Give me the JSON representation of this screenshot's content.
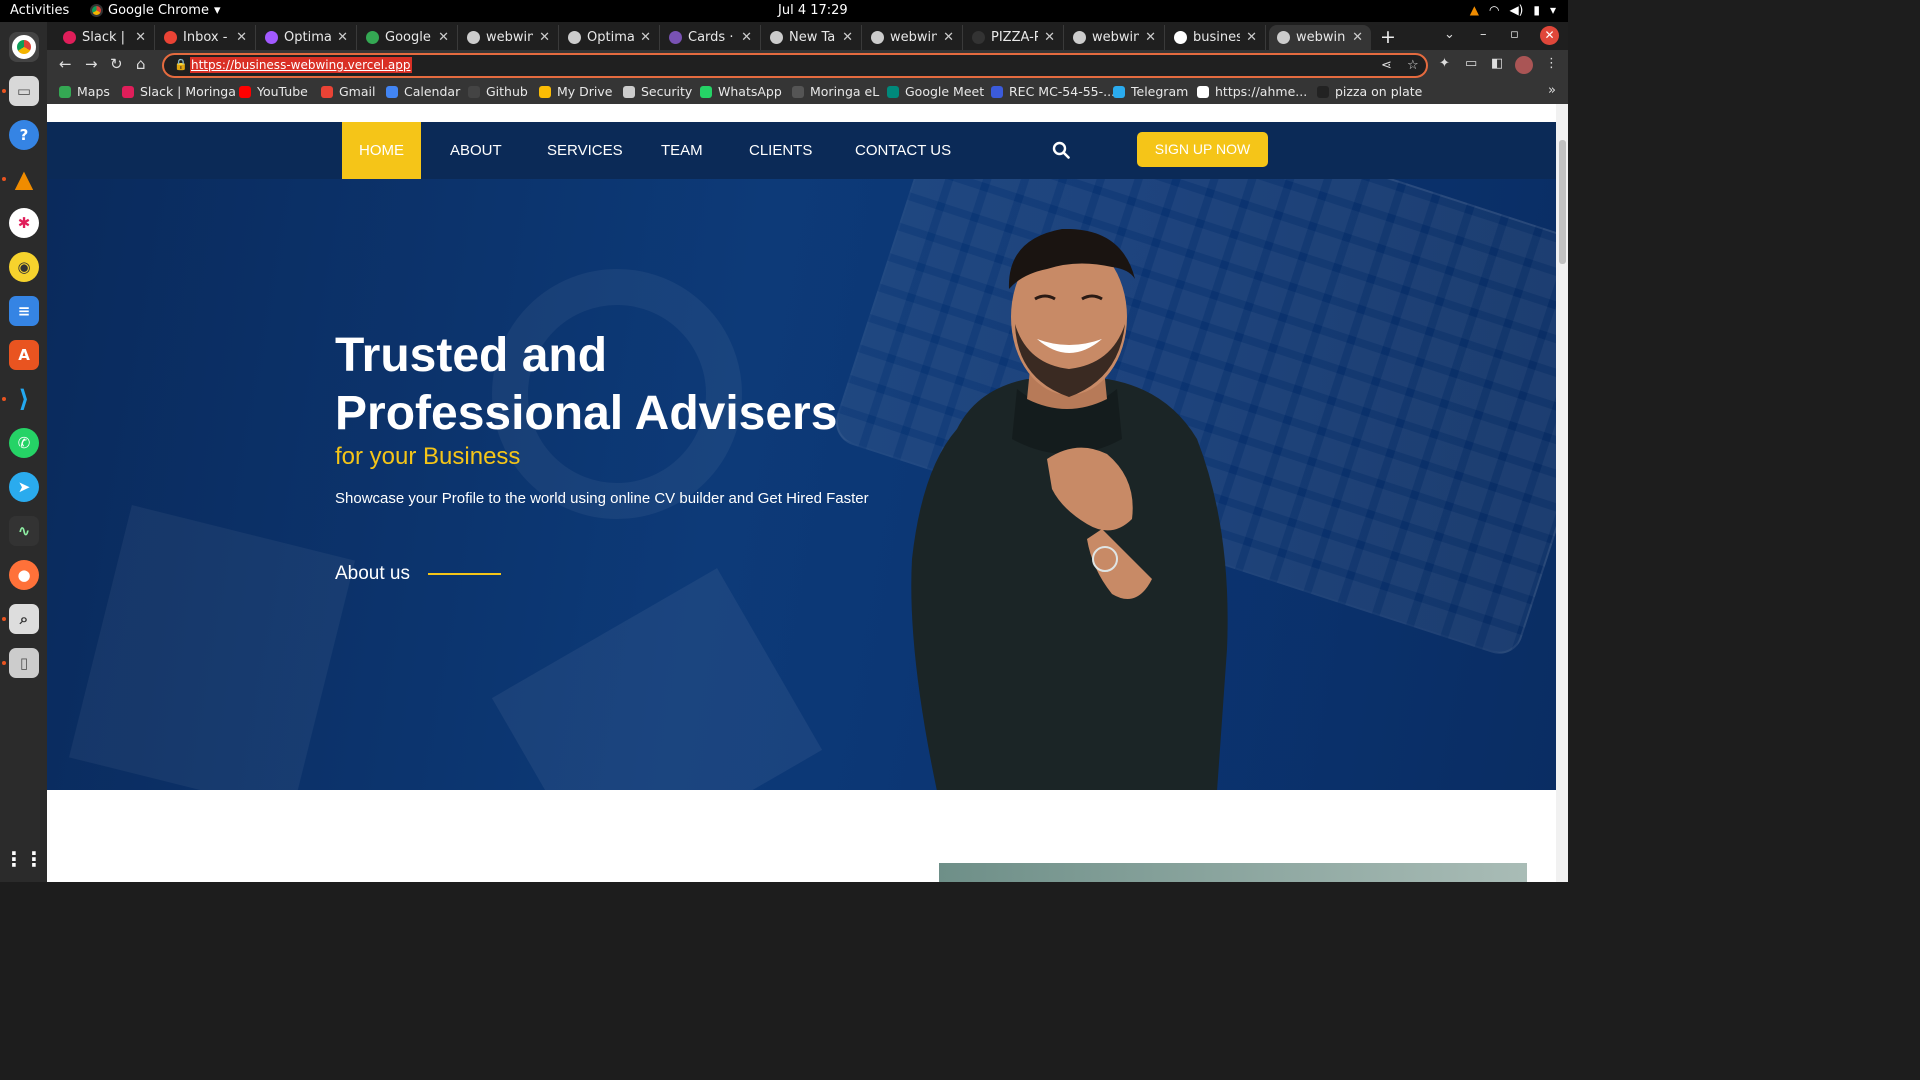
{
  "system": {
    "activities": "Activities",
    "app_name": "Google Chrome",
    "clock": "Jul 4  17:29"
  },
  "tabs": [
    {
      "label": "Slack | Al",
      "color": "#e01e5a"
    },
    {
      "label": "Inbox - k",
      "color": "#ea4335"
    },
    {
      "label": "Optimal",
      "color": "#a259ff"
    },
    {
      "label": "Google M",
      "color": "#34a853"
    },
    {
      "label": "webwinc",
      "color": "#cccccc"
    },
    {
      "label": "Optimal",
      "color": "#cccccc"
    },
    {
      "label": "Cards · B",
      "color": "#7952b3"
    },
    {
      "label": "New Tab",
      "color": "#cccccc"
    },
    {
      "label": "webwinc",
      "color": "#cccccc"
    },
    {
      "label": "PIZZA-Pa",
      "color": "#333333"
    },
    {
      "label": "webwinc",
      "color": "#cccccc"
    },
    {
      "label": "business",
      "color": "#ffffff"
    },
    {
      "label": "webwinc",
      "color": "#cccccc"
    }
  ],
  "toolbar": {
    "url": "https://business-webwing.vercel.app"
  },
  "bookmarks": [
    {
      "label": "Maps",
      "color": "#34a853"
    },
    {
      "label": "Slack | Moringa",
      "color": "#e01e5a"
    },
    {
      "label": "YouTube",
      "color": "#ff0000"
    },
    {
      "label": "Gmail",
      "color": "#ea4335"
    },
    {
      "label": "Calendar",
      "color": "#4285f4"
    },
    {
      "label": "Github",
      "color": "#444444"
    },
    {
      "label": "My Drive",
      "color": "#fbbc04"
    },
    {
      "label": "Security",
      "color": "#cccccc"
    },
    {
      "label": "WhatsApp",
      "color": "#25d366"
    },
    {
      "label": "Moringa eL",
      "color": "#555555"
    },
    {
      "label": "Google Meet",
      "color": "#00897b"
    },
    {
      "label": "REC MC-54-55-...",
      "color": "#3b5bdb"
    },
    {
      "label": "Telegram",
      "color": "#2aabee"
    },
    {
      "label": "https://ahme...",
      "color": "#ffffff"
    },
    {
      "label": "pizza on plate",
      "color": "#222222"
    }
  ],
  "site": {
    "nav": [
      "HOME",
      "ABOUT",
      "SERVICES",
      "TEAM",
      "CLIENTS",
      "CONTACT US"
    ],
    "signup": "SIGN UP NOW",
    "hero": {
      "title_line1": "Trusted and",
      "title_line2": "Professional Advisers",
      "subtitle": "for your Business",
      "description": "Showcase your Profile to the world using online CV builder and Get Hired Faster",
      "about_link": "About us"
    },
    "colors": {
      "navy": "#0b2a57",
      "accent": "#f5c518"
    }
  }
}
